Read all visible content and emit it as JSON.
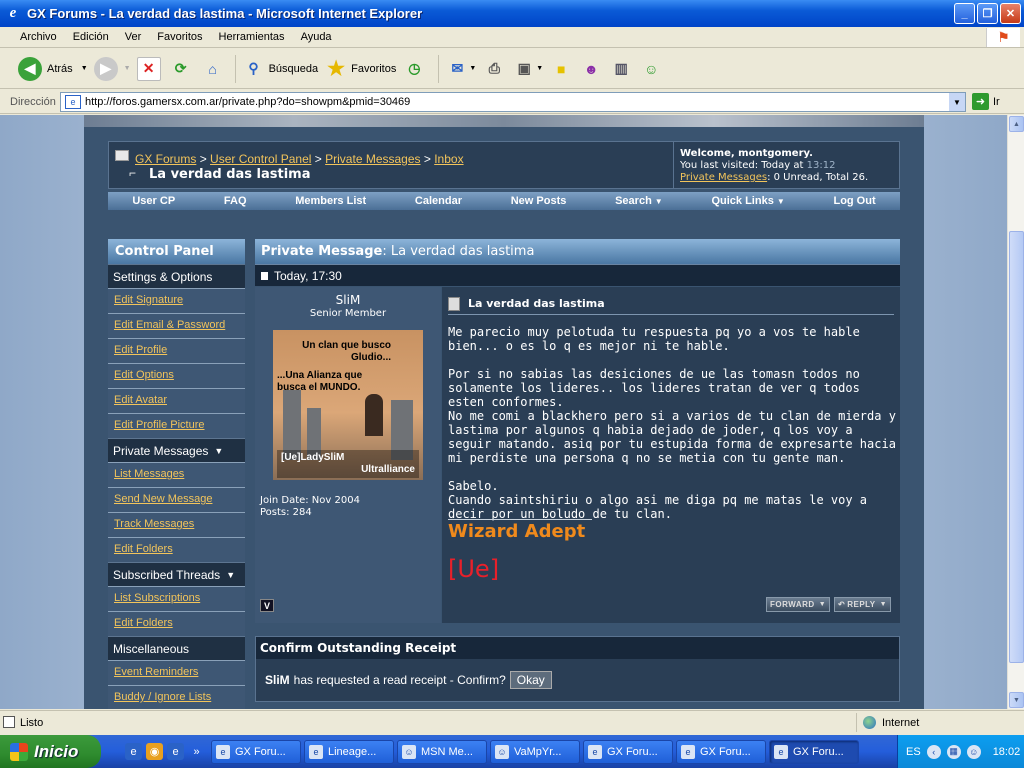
{
  "window": {
    "title": "GX Forums - La verdad das lastima - Microsoft Internet Explorer",
    "minimize": "_",
    "maximize": "❐",
    "close": "✕"
  },
  "menu": [
    "Archivo",
    "Edición",
    "Ver",
    "Favoritos",
    "Herramientas",
    "Ayuda"
  ],
  "toolbar": {
    "back": "Atrás",
    "search": "Búsqueda",
    "favorites": "Favoritos"
  },
  "address": {
    "label": "Dirección",
    "url": "http://foros.gamersx.com.ar/private.php?do=showpm&pmid=30469",
    "go": "Ir"
  },
  "breadcrumb": {
    "home": "GX Forums",
    "sep": ">",
    "ucp": "User Control Panel",
    "pm": "Private Messages",
    "inbox": "Inbox"
  },
  "page_title": "La verdad das lastima",
  "welcome": {
    "greeting": "Welcome, montgomery.",
    "last_visited_label": "You last visited: Today at",
    "last_visited_time": "13:12",
    "pm_link": "Private Messages",
    "pm_counts": ": 0 Unread, Total 26."
  },
  "nav": [
    {
      "label": "User CP"
    },
    {
      "label": "FAQ"
    },
    {
      "label": "Members List"
    },
    {
      "label": "Calendar"
    },
    {
      "label": "New Posts"
    },
    {
      "label": "Search"
    },
    {
      "label": "Quick Links"
    },
    {
      "label": "Log Out"
    }
  ],
  "sidebar": {
    "title": "Control Panel",
    "settings_header": "Settings & Options",
    "settings": [
      "Edit Signature",
      "Edit Email & Password",
      "Edit Profile",
      "Edit Options",
      "Edit Avatar",
      "Edit Profile Picture"
    ],
    "pm_header": "Private Messages",
    "pm": [
      "List Messages",
      "Send New Message",
      "Track Messages",
      "Edit Folders"
    ],
    "threads_header": "Subscribed Threads",
    "threads": [
      "List Subscriptions",
      "Edit Folders"
    ],
    "misc_header": "Miscellaneous",
    "misc": [
      "Event Reminders",
      "Buddy / Ignore Lists"
    ]
  },
  "pm": {
    "header_label": "Private Message",
    "header_sep": ":",
    "header_subject": "La verdad das lastima",
    "date": "Today, 17:30",
    "subject": "La verdad das lastima",
    "paragraphs": [
      "Me parecio muy pelotuda tu respuesta pq yo a vos te hable bien... o es lo q es mejor ni te hable.",
      "Por si no sabias las desiciones de ue las tomasn todos no solamente los lideres.. los lideres tratan de ver q todos esten conformes.",
      "No me comi a blackhero pero si a varios de tu clan de mierda y lastima por algunos q habia dejado de joder, q los voy a seguir matando. asiq por tu estupida forma de expresarte hacia mi perdiste una persona q no se metia con tu gente man.",
      "Sabelo.",
      "Cuando saintshiriu o algo asi me diga pq me matas le voy a decir por un boludo de tu clan."
    ],
    "signature_line1": "Wizard Adept",
    "signature_line2": "[Ue]",
    "forward": "FORWARD",
    "reply": "REPLY"
  },
  "user": {
    "name": "SliM",
    "rank": "Senior Member",
    "avatar_text1": "Un clan que busco Gludio...",
    "avatar_text2": "...Una Alianza que busca el MUNDO.",
    "avatar_footer1": "[Ue]LadySliM",
    "avatar_footer2": "Ultralliance",
    "join_date": "Join Date: Nov 2004",
    "posts": "Posts: 284",
    "vb_badge": "V"
  },
  "receipt": {
    "title": "Confirm Outstanding Receipt",
    "user": "SliM",
    "text": "has requested a read receipt - Confirm?",
    "button": "Okay"
  },
  "status": {
    "text": "Listo",
    "zone": "Internet"
  },
  "taskbar": {
    "start": "Inicio",
    "tasks": [
      {
        "label": "GX Foru..."
      },
      {
        "label": "Lineage..."
      },
      {
        "label": "MSN Me..."
      },
      {
        "label": "VaMpYr..."
      },
      {
        "label": "GX Foru..."
      },
      {
        "label": "GX Foru..."
      },
      {
        "label": "GX Foru..."
      }
    ],
    "lang": "ES",
    "clock": "18:02"
  }
}
